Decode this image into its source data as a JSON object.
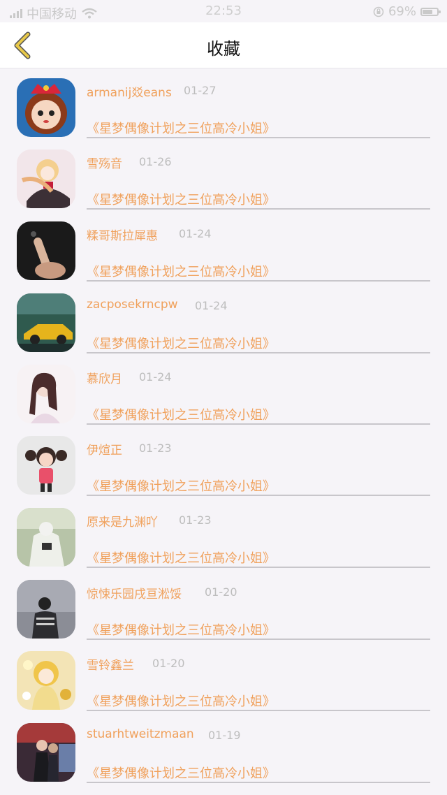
{
  "status_bar": {
    "carrier": "中国移动",
    "time": "22:53",
    "battery": "69%"
  },
  "header": {
    "title": "收藏",
    "back_icon": "chevron-left-icon",
    "accent_color": "#e8c94a"
  },
  "colors": {
    "name": "#f0a15c",
    "date": "#bdbdbd",
    "divider": "#c8c6cb"
  },
  "items": [
    {
      "name": "armanij㸚eans",
      "date": "01-27",
      "work": "《星梦偶像计划之三位高冷小姐》"
    },
    {
      "name": "雪殇音",
      "date": "01-26",
      "work": "《星梦偶像计划之三位高冷小姐》"
    },
    {
      "name": "糅哥斯拉犀惠",
      "date": "01-24",
      "work": "《星梦偶像计划之三位高冷小姐》"
    },
    {
      "name": "zacposekrncpw",
      "date": "01-24",
      "work": "《星梦偶像计划之三位高冷小姐》"
    },
    {
      "name": "慕欣月",
      "date": "01-24",
      "work": "《星梦偶像计划之三位高冷小姐》"
    },
    {
      "name": "伊煊正",
      "date": "01-23",
      "work": "《星梦偶像计划之三位高冷小姐》"
    },
    {
      "name": "原来是九渊吖",
      "date": "01-23",
      "work": "《星梦偶像计划之三位高冷小姐》"
    },
    {
      "name": "惊悚乐园戌亘淞馁",
      "date": "01-20",
      "work": "《星梦偶像计划之三位高冷小姐》"
    },
    {
      "name": "雪铃鑫兰",
      "date": "01-20",
      "work": "《星梦偶像计划之三位高冷小姐》"
    },
    {
      "name": "stuarhtweitzmaan",
      "date": "01-19",
      "work": "《星梦偶像计划之三位高冷小姐》"
    }
  ]
}
